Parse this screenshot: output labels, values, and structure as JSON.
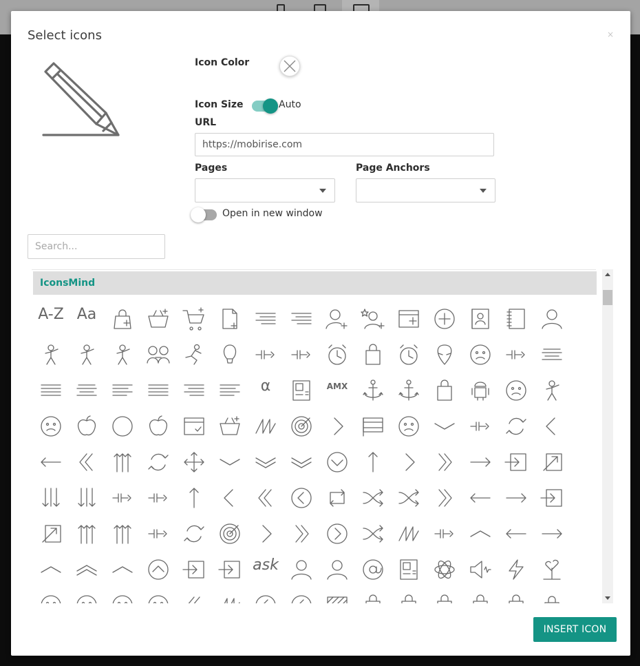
{
  "dialog": {
    "title": "Select icons",
    "close_glyph": "×"
  },
  "preview": {
    "icon": "pencil-icon"
  },
  "settings": {
    "icon_color_label": "Icon Color",
    "icon_size_label": "Icon Size",
    "auto_label": "Auto",
    "auto_enabled": true,
    "url_label": "URL",
    "url_value": "https://mobirise.com",
    "pages_label": "Pages",
    "pages_value": "",
    "anchors_label": "Page Anchors",
    "anchors_value": "",
    "new_window_label": "Open in new window",
    "new_window_enabled": false
  },
  "search": {
    "placeholder": "Search..."
  },
  "library": {
    "name": "IconsMind",
    "rows": [
      [
        "text-a-z-icon",
        "font-aa-icon",
        "shopping-bag-add-icon",
        "basket-add-icon",
        "cart-add-icon",
        "file-add-icon",
        "text-indent-icon",
        "list-indent-icon",
        "user-add-icon",
        "user-star-add-icon",
        "browser-window-add-icon",
        "add-circle-icon",
        "address-book-icon",
        "notebook-icon",
        "user-icon"
      ],
      [
        "aerobics-icon",
        "aerobics-2-icon",
        "aerobics-3-icon",
        "couple-icon",
        "running-man-icon",
        "hot-air-balloon-icon",
        "airbrush-icon",
        "airship-icon",
        "alarm-clock-icon",
        "alarm-clock-2-icon",
        "alarm-clock-3-icon",
        "alien-icon",
        "alien-2-icon",
        "aligator-icon",
        "align-center-icon"
      ],
      [
        "align-justify-all-icon",
        "align-justify-center-icon",
        "align-justify-left-icon",
        "align-justify-right-icon",
        "align-right-icon",
        "align-left-icon",
        "alpha-icon",
        "ambulance-icon",
        "amx-icon",
        "anchor-icon",
        "anchor-2-icon",
        "android-store-icon",
        "android-icon",
        "angel-smiley-icon",
        "angel-icon"
      ],
      [
        "angry-face-icon",
        "apple-icon",
        "apple-bite-icon",
        "apple-store-icon",
        "approved-window-icon",
        "aquarius-icon",
        "aquarius-2-icon",
        "archery-target-icon",
        "archery-bow-icon",
        "argentina-flag-icon",
        "aries-icon",
        "aries-2-icon",
        "army-key-icon",
        "arrow-around-icon",
        "arrow-back-icon"
      ],
      [
        "arrow-back-2-icon",
        "arrow-back-3-icon",
        "arrow-barrier-icon",
        "arrow-circle-icon",
        "arrow-cross-icon",
        "arrow-down-icon",
        "arrow-down-2-icon",
        "arrow-down-3-icon",
        "arrow-down-circle-icon",
        "arrow-fork-icon",
        "arrow-forward-icon",
        "arrow-forward-2-icon",
        "arrow-from-icon",
        "arrow-inside-icon",
        "arrow-inside-45-icon"
      ],
      [
        "arrow-inside-gap-icon",
        "arrow-inside-gap-45-icon",
        "arrow-into-icon",
        "arrow-join-icon",
        "arrow-junction-icon",
        "arrow-left-icon",
        "arrow-left-2-icon",
        "arrow-left-circle-icon",
        "arrow-loop-icon",
        "arrow-merge-icon",
        "arrow-mix-icon",
        "arrow-next-icon",
        "arrow-outleft-icon",
        "arrow-outright-icon",
        "arrow-outside-icon"
      ],
      [
        "arrow-outside-45-icon",
        "arrow-outside-gap-icon",
        "arrow-outside-gap-45-icon",
        "arrow-over-icon",
        "arrow-refresh-icon",
        "arrow-refresh-2-icon",
        "arrow-right-icon",
        "arrow-right-2-icon",
        "arrow-right-circle-icon",
        "arrow-shuffle-icon",
        "arrow-squiggly-icon",
        "arrow-through-icon",
        "arrow-to-icon",
        "arrow-turn-left-icon",
        "arrow-turn-right-icon"
      ],
      [
        "arrow-up-icon",
        "arrow-up-2-icon",
        "arrow-up-3-icon",
        "arrow-up-circle-icon",
        "arrow-x-left-icon",
        "arrow-x-right-icon",
        "ask-icon",
        "assistant-icon",
        "astronaut-icon",
        "at-sign-icon",
        "atm-icon",
        "atom-icon",
        "audio-icon",
        "auto-flash-icon",
        "autumn-icon"
      ],
      [
        "baby-clothes-icon",
        "baby-clothes-2-icon",
        "baby-cry-icon",
        "baby-icon",
        "back-2-icon",
        "back-media-icon",
        "back-music-icon",
        "back-icon",
        "background-icon",
        "bacteria-icon",
        "bag-icon",
        "bag-coins-icon",
        "bag-items-icon",
        "bag-quantity-icon",
        "bag-2-icon"
      ]
    ]
  },
  "insert_button_label": "INSERT ICON"
}
